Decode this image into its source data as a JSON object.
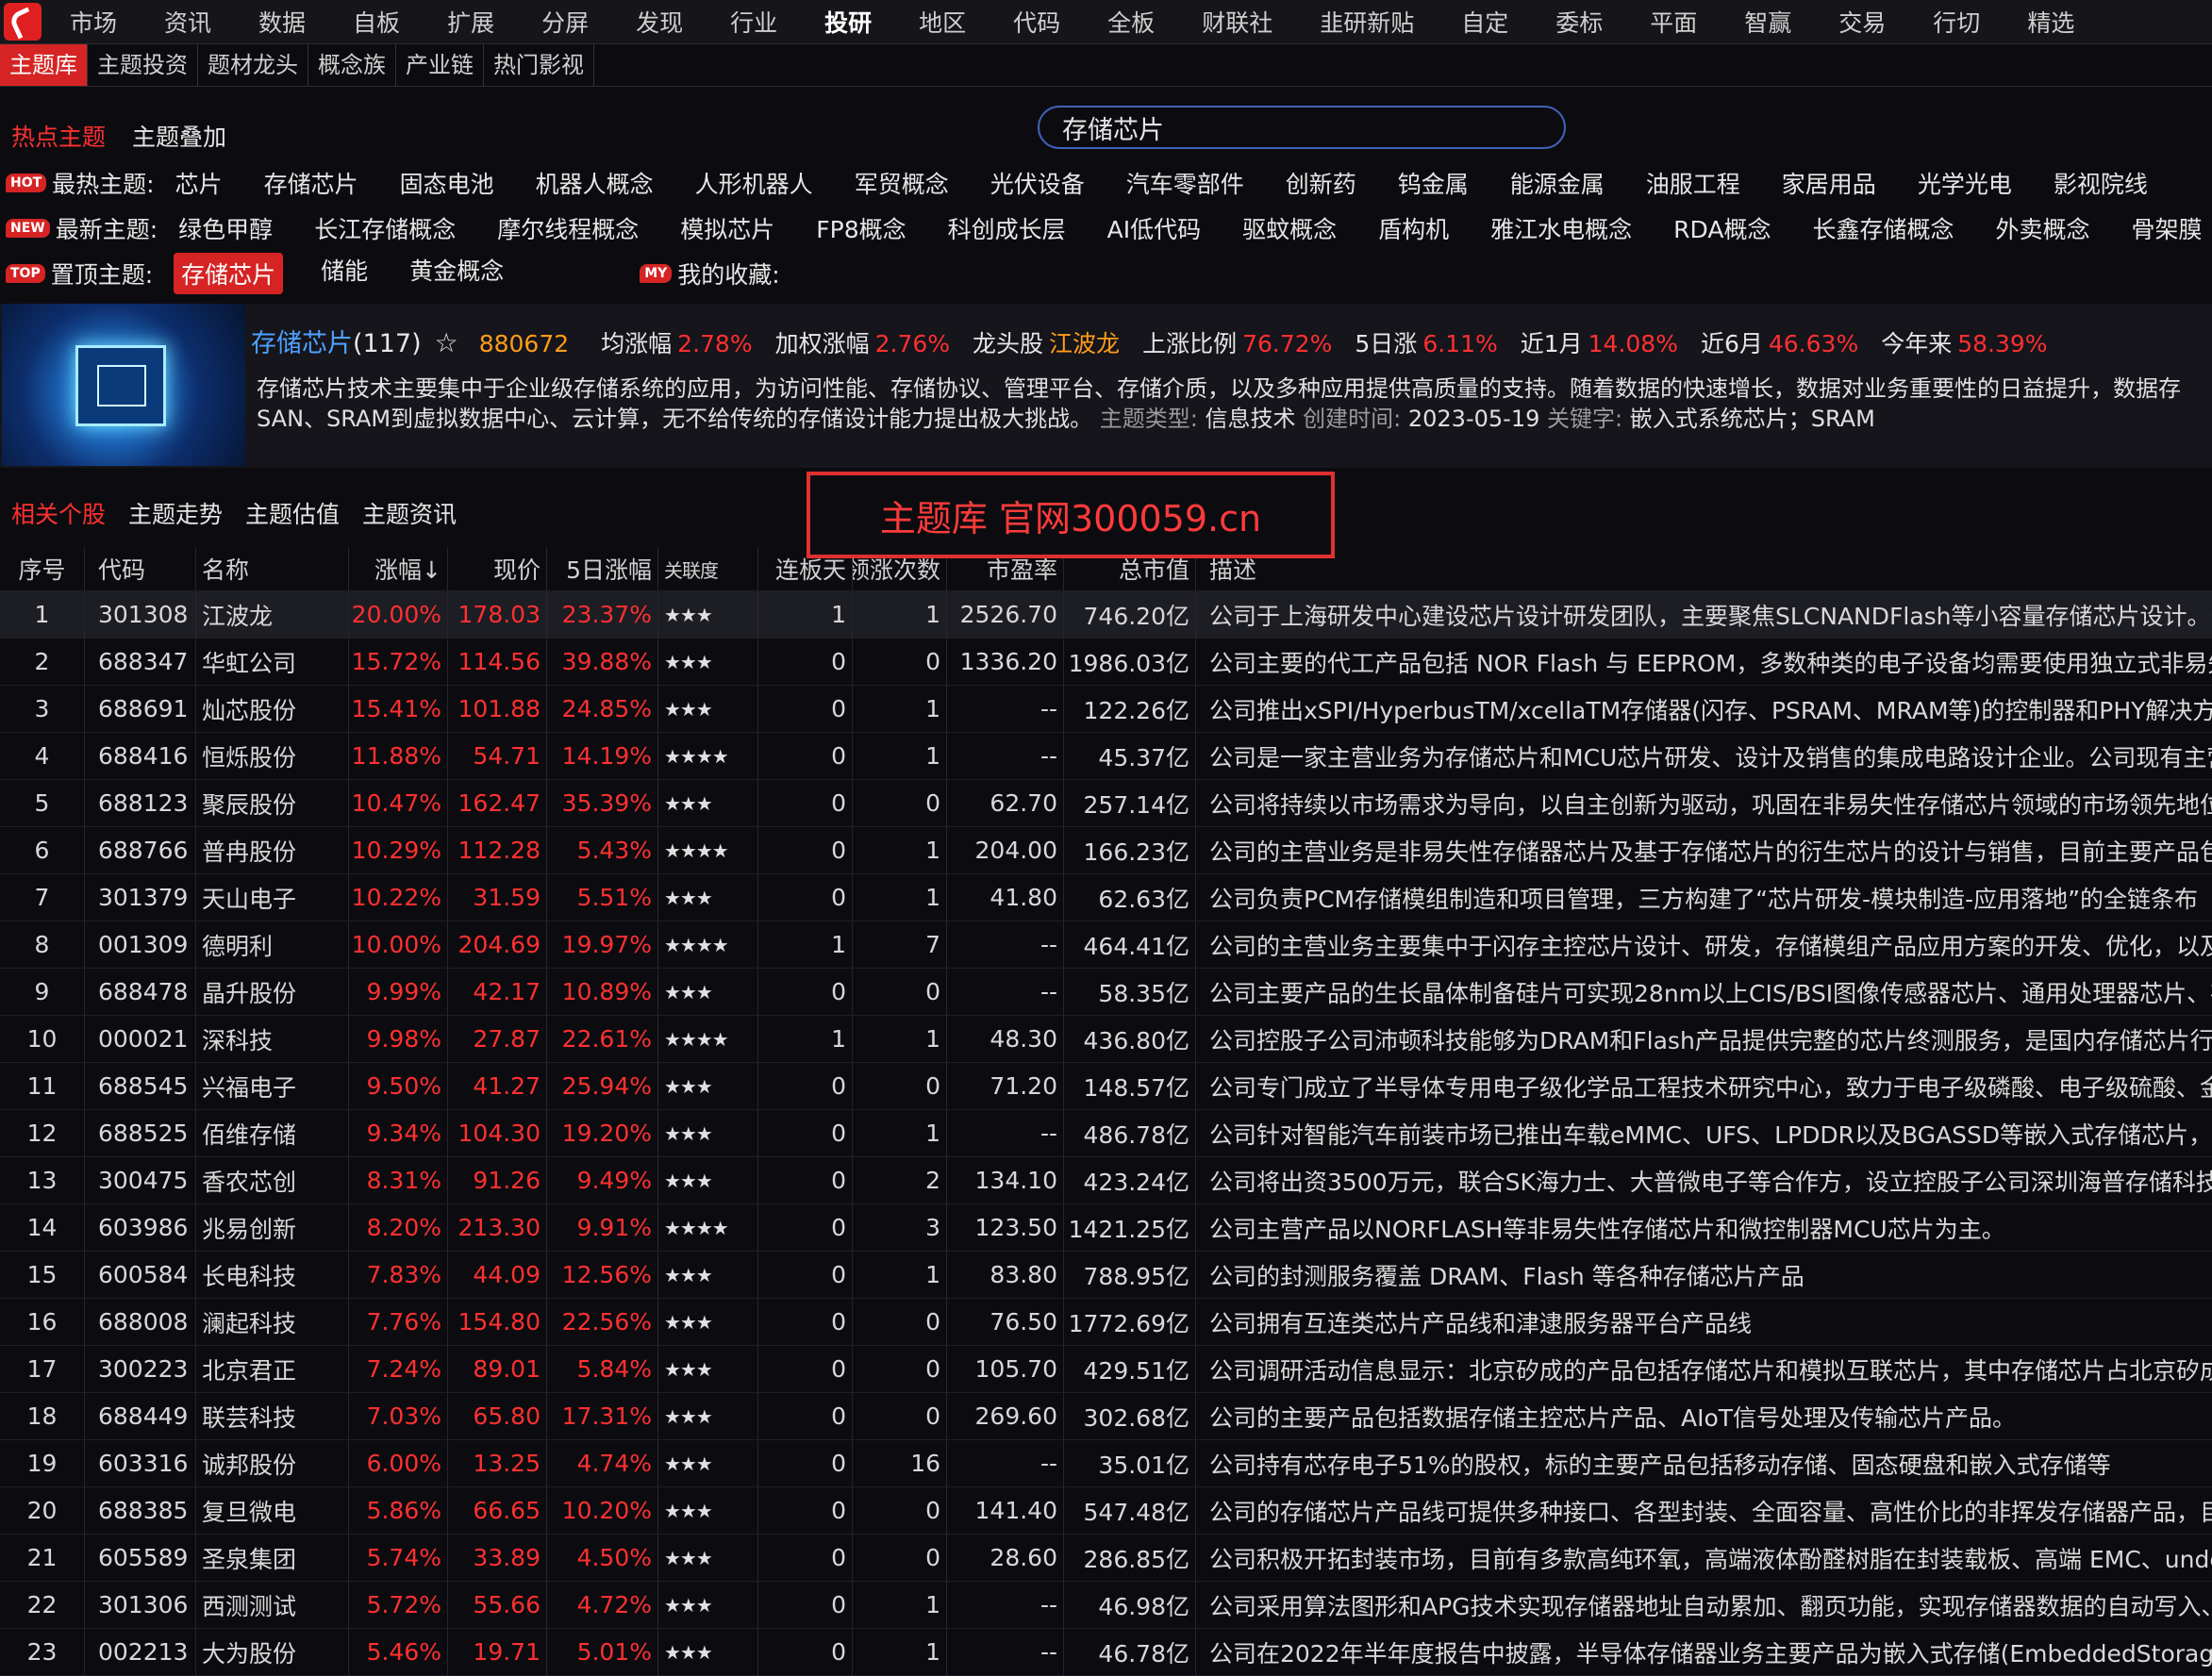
{
  "top_menu": [
    "市场",
    "资讯",
    "数据",
    "自板",
    "扩展",
    "分屏",
    "发现",
    "行业",
    "投研",
    "地区",
    "代码",
    "全板",
    "财联社",
    "韭研新贴",
    "自定",
    "委标",
    "平面",
    "智赢",
    "交易",
    "行切",
    "精选"
  ],
  "top_menu_active": "投研",
  "sub_tabs": [
    "主题库",
    "主题投资",
    "题材龙头",
    "概念族",
    "产业链",
    "热门影视"
  ],
  "section_tabs": {
    "hot": "热点主题",
    "overlay": "主题叠加"
  },
  "search": {
    "value": "存储芯片"
  },
  "hot_row": {
    "badge": "HOT",
    "label": "最热主题:",
    "tags": [
      "芯片",
      "存储芯片",
      "固态电池",
      "机器人概念",
      "人形机器人",
      "军贸概念",
      "光伏设备",
      "汽车零部件",
      "创新药",
      "钨金属",
      "能源金属",
      "油服工程",
      "家居用品",
      "光学光电",
      "影视院线"
    ]
  },
  "new_row": {
    "badge": "NEW",
    "label": "最新主题:",
    "tags": [
      "绿色甲醇",
      "长江存储概念",
      "摩尔线程概念",
      "模拟芯片",
      "FP8概念",
      "科创成长层",
      "AI低代码",
      "驱蚊概念",
      "盾构机",
      "雅江水电概念",
      "RDA概念",
      "长鑫存储概念",
      "外卖概念",
      "骨架膜"
    ]
  },
  "top_row": {
    "badge": "TOP",
    "label": "置顶主题:",
    "tags": [
      "存储芯片",
      "储能",
      "黄金概念"
    ],
    "fav_badge": "MY",
    "fav_label": "我的收藏:"
  },
  "theme": {
    "name": "存储芯片",
    "count": "(117)",
    "star": "☆",
    "code": "880672",
    "stats": [
      {
        "k": "均涨幅",
        "v": "2.78%"
      },
      {
        "k": "加权涨幅",
        "v": "2.76%"
      },
      {
        "k": "龙头股",
        "v": "江波龙",
        "orange": true
      },
      {
        "k": "上涨比例",
        "v": "76.72%"
      },
      {
        "k": "5日涨",
        "v": "6.11%"
      },
      {
        "k": "近1月",
        "v": "14.08%"
      },
      {
        "k": "近6月",
        "v": "46.63%"
      },
      {
        "k": "今年来",
        "v": "58.39%"
      }
    ],
    "desc_line1": "存储芯片技术主要集中于企业级存储系统的应用，为访问性能、存储协议、管理平台、存储介质，以及多种应用提供高质量的支持。随着数据的快速增长，数据对业务重要性的日益提升，数据存",
    "desc_line2": "SAN、SRAM到虚拟数据中心、云计算，无不给传统的存储设计能力提出极大挑战。",
    "meta_type_k": "主题类型:",
    "meta_type_v": "信息技术",
    "meta_date_k": "创建时间:",
    "meta_date_v": "2023-05-19",
    "meta_kw_k": "关键字:",
    "meta_kw_v": "嵌入式系统芯片；SRAM"
  },
  "stock_tabs": [
    "相关个股",
    "主题走势",
    "主题估值",
    "主题资讯"
  ],
  "watermark": "主题库 官网300059.cn",
  "table": {
    "headers": [
      "序号",
      "代码",
      "名称",
      "涨幅↓",
      "现价",
      "5日涨幅",
      "关联度",
      "连板天",
      "领涨次数",
      "市盈率",
      "总市值",
      "描述"
    ],
    "rows": [
      [
        "1",
        "301308",
        "江波龙",
        "20.00%",
        "178.03",
        "23.37%",
        "★★★",
        "1",
        "1",
        "2526.70",
        "746.20亿",
        "公司于上海研发中心建设芯片设计研发团队，主要聚焦SLCNANDFlash等小容量存储芯片设计。公"
      ],
      [
        "2",
        "688347",
        "华虹公司",
        "15.72%",
        "114.56",
        "39.88%",
        "★★★",
        "0",
        "0",
        "1336.20",
        "1986.03亿",
        "公司主要的代工产品包括 NOR Flash 与 EEPROM，多数种类的电子设备均需要使用独立式非易失"
      ],
      [
        "3",
        "688691",
        "灿芯股份",
        "15.41%",
        "101.88",
        "24.85%",
        "★★★",
        "0",
        "1",
        "--",
        "122.26亿",
        "公司推出xSPI/HyperbusTM/xcellaTM存储器(闪存、PSRAM、MRAM等)的控制器和PHY解决方"
      ],
      [
        "4",
        "688416",
        "恒烁股份",
        "11.88%",
        "54.71",
        "14.19%",
        "★★★★",
        "0",
        "1",
        "--",
        "45.37亿",
        "公司是一家主营业务为存储芯片和MCU芯片研发、设计及销售的集成电路设计企业。公司现有主营"
      ],
      [
        "5",
        "688123",
        "聚辰股份",
        "10.47%",
        "162.47",
        "35.39%",
        "★★★",
        "0",
        "0",
        "62.70",
        "257.14亿",
        "公司将持续以市场需求为导向，以自主创新为驱动，巩固在非易失性存储芯片领域的市场领先地位"
      ],
      [
        "6",
        "688766",
        "普冉股份",
        "10.29%",
        "112.28",
        "5.43%",
        "★★★★",
        "0",
        "1",
        "204.00",
        "166.23亿",
        "公司的主营业务是非易失性存储器芯片及基于存储芯片的衍生芯片的设计与销售，目前主要产品包"
      ],
      [
        "7",
        "301379",
        "天山电子",
        "10.22%",
        "31.59",
        "5.51%",
        "★★★",
        "0",
        "1",
        "41.80",
        "62.63亿",
        "公司负责PCM存储模组制造和项目管理，三方构建了“芯片研发-模块制造-应用落地”的全链条布"
      ],
      [
        "8",
        "001309",
        "德明利",
        "10.00%",
        "204.69",
        "19.97%",
        "★★★★",
        "1",
        "7",
        "--",
        "464.41亿",
        "公司的主营业务主要集中于闪存主控芯片设计、研发，存储模组产品应用方案的开发、优化，以及"
      ],
      [
        "9",
        "688478",
        "晶升股份",
        "9.99%",
        "42.17",
        "10.89%",
        "★★★",
        "0",
        "0",
        "--",
        "58.35亿",
        "公司主要产品的生长晶体制备硅片可实现28nm以上CIS/BSI图像传感器芯片、通用处理器芯片、存"
      ],
      [
        "10",
        "000021",
        "深科技",
        "9.98%",
        "27.87",
        "22.61%",
        "★★★★",
        "1",
        "1",
        "48.30",
        "436.80亿",
        "公司控股子公司沛顿科技能够为DRAM和Flash产品提供完整的芯片终测服务，是国内存储芯片行业"
      ],
      [
        "11",
        "688545",
        "兴福电子",
        "9.50%",
        "41.27",
        "25.94%",
        "★★★",
        "0",
        "0",
        "71.20",
        "148.57亿",
        "公司专门成立了半导体专用电子级化学品工程技术研究中心，致力于电子级磷酸、电子级硫酸、金"
      ],
      [
        "12",
        "688525",
        "佰维存储",
        "9.34%",
        "104.30",
        "19.20%",
        "★★★",
        "0",
        "1",
        "--",
        "486.78亿",
        "公司针对智能汽车前装市场已推出车载eMMC、UFS、LPDDR以及BGASSD等嵌入式存储芯片，目"
      ],
      [
        "13",
        "300475",
        "香农芯创",
        "8.31%",
        "91.26",
        "9.49%",
        "★★★",
        "0",
        "2",
        "134.10",
        "423.24亿",
        "公司将出资3500万元，联合SK海力士、大普微电子等合作方，设立控股子公司深圳海普存储科技有"
      ],
      [
        "14",
        "603986",
        "兆易创新",
        "8.20%",
        "213.30",
        "9.91%",
        "★★★★",
        "0",
        "3",
        "123.50",
        "1421.25亿",
        "公司主营产品以NORFLASH等非易失性存储芯片和微控制器MCU芯片为主。"
      ],
      [
        "15",
        "600584",
        "长电科技",
        "7.83%",
        "44.09",
        "12.56%",
        "★★★",
        "0",
        "1",
        "83.80",
        "788.95亿",
        "公司的封测服务覆盖 DRAM、Flash 等各种存储芯片产品"
      ],
      [
        "16",
        "688008",
        "澜起科技",
        "7.76%",
        "154.80",
        "22.56%",
        "★★★",
        "0",
        "0",
        "76.50",
        "1772.69亿",
        "公司拥有互连类芯片产品线和津逮服务器平台产品线"
      ],
      [
        "17",
        "300223",
        "北京君正",
        "7.24%",
        "89.01",
        "5.84%",
        "★★★",
        "0",
        "0",
        "105.70",
        "429.51亿",
        "公司调研活动信息显示：北京矽成的产品包括存储芯片和模拟互联芯片，其中存储芯片占北京矽成"
      ],
      [
        "18",
        "688449",
        "联芸科技",
        "7.03%",
        "65.80",
        "17.31%",
        "★★★",
        "0",
        "0",
        "269.60",
        "302.68亿",
        "公司的主要产品包括数据存储主控芯片产品、AIoT信号处理及传输芯片产品。"
      ],
      [
        "19",
        "603316",
        "诚邦股份",
        "6.00%",
        "13.25",
        "4.74%",
        "★★★",
        "0",
        "16",
        "--",
        "35.01亿",
        "公司持有芯存电子51%的股权，标的主要产品包括移动存储、固态硬盘和嵌入式存储等"
      ],
      [
        "20",
        "688385",
        "复旦微电",
        "5.86%",
        "66.65",
        "10.20%",
        "★★★",
        "0",
        "0",
        "141.40",
        "547.48亿",
        "公司的存储芯片产品线可提供多种接口、各型封装、全面容量、高性价比的非挥发存储器产品，目"
      ],
      [
        "21",
        "605589",
        "圣泉集团",
        "5.74%",
        "33.89",
        "4.50%",
        "★★★",
        "0",
        "0",
        "28.60",
        "286.85亿",
        "公司积极开拓封装市场，目前有多款高纯环氧，高端液体酚醛树脂在封装载板、高端 EMC、under"
      ],
      [
        "22",
        "301306",
        "西测测试",
        "5.72%",
        "55.66",
        "4.72%",
        "★★★",
        "0",
        "1",
        "--",
        "46.98亿",
        "公司采用算法图形和APG技术实现存储器地址自动累加、翻页功能，实现存储器数据的自动写入、"
      ],
      [
        "23",
        "002213",
        "大为股份",
        "5.46%",
        "19.71",
        "5.01%",
        "★★★",
        "0",
        "1",
        "--",
        "46.78亿",
        "公司在2022年半年度报告中披露，半导体存储器业务主要产品为嵌入式存储(EmbeddedStorage)"
      ]
    ]
  },
  "colors": {
    "accent_red": "#d62424",
    "up_red": "#ff3030",
    "orange": "#ff9c1a",
    "link_blue": "#4ea0ff"
  }
}
